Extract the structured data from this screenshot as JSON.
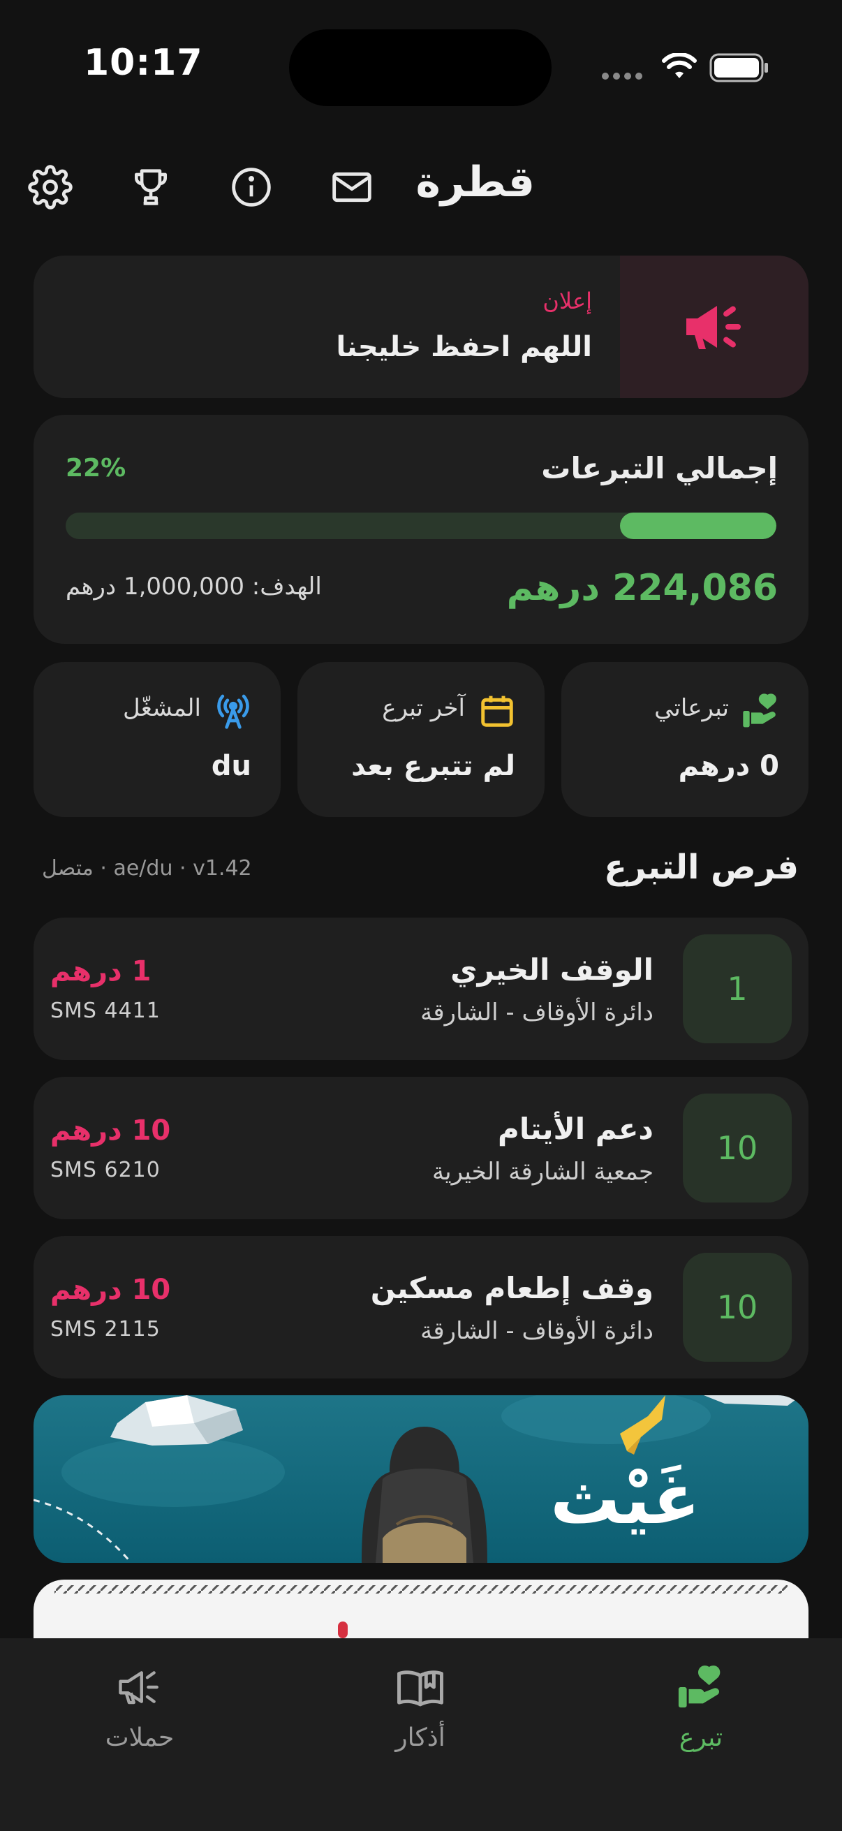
{
  "status_bar": {
    "time": "10:17"
  },
  "header": {
    "brand": "قطرة",
    "icons": [
      "mail-icon",
      "info-icon",
      "trophy-icon",
      "gear-icon"
    ]
  },
  "announcement": {
    "label": "إعلان",
    "text": "اللهم احفظ خليجنا",
    "icon": "megaphone-icon",
    "accent": "#E8306A"
  },
  "total": {
    "title": "إجمالي التبرعات",
    "percent_label": "22%",
    "progress": 0.22,
    "amount": "224,086 درهم",
    "goal": "الهدف: 1,000,000 درهم",
    "accent": "#5DBA62"
  },
  "stats": [
    {
      "label": "تبرعاتي",
      "value": "0 درهم",
      "icon": "donate-hand-icon"
    },
    {
      "label": "آخر تبرع",
      "value": "لم تتبرع بعد",
      "icon": "calendar-icon"
    },
    {
      "label": "المشغّل",
      "value": "du",
      "icon": "antenna-icon"
    }
  ],
  "section": {
    "title": "فرص التبرع",
    "meta": "متصل · ae/du · v1.42"
  },
  "opportunities": [
    {
      "badge": "1",
      "title": "الوقف الخيري",
      "org": "دائرة الأوقاف - الشارقة",
      "price": "1 درهم",
      "sms": "SMS 4411"
    },
    {
      "badge": "10",
      "title": "دعم الأيتام",
      "org": "جمعية الشارقة الخيرية",
      "price": "10 درهم",
      "sms": "SMS 6210"
    },
    {
      "badge": "10",
      "title": "وقف إطعام مسكين",
      "org": "دائرة الأوقاف - الشارقة",
      "price": "10 درهم",
      "sms": "SMS 2115"
    }
  ],
  "banner": {
    "title": "غَيْث"
  },
  "tabs": [
    {
      "label": "تبرع",
      "icon": "donate-hand-icon",
      "active": true
    },
    {
      "label": "أذكار",
      "icon": "book-icon",
      "active": false
    },
    {
      "label": "حملات",
      "icon": "megaphone-icon",
      "active": false
    }
  ]
}
